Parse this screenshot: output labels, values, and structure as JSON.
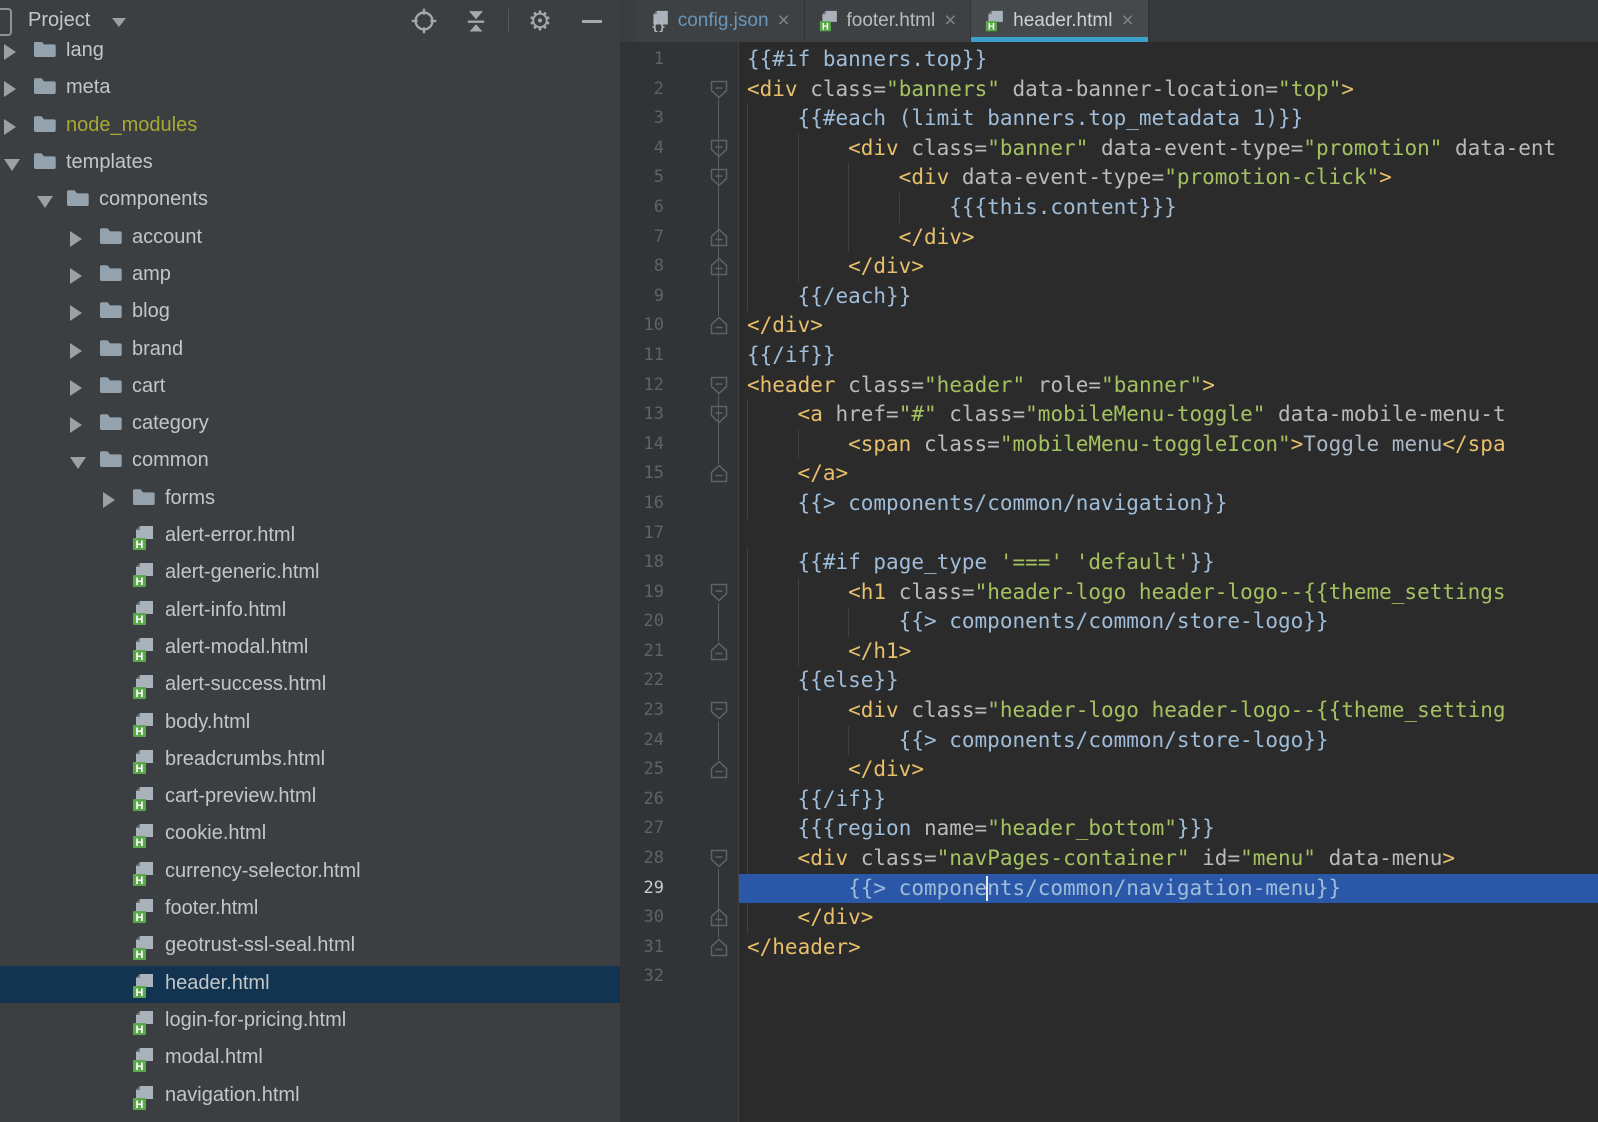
{
  "window": {
    "left_toolbar": {
      "title": "Project",
      "icons": [
        {
          "name": "locate-icon"
        },
        {
          "name": "collapse-all-icon"
        },
        {
          "name": "settings-gear-icon"
        },
        {
          "name": "hide-panel-icon"
        }
      ]
    }
  },
  "project_tree": {
    "items": [
      {
        "label": "lang",
        "level": 0,
        "kind": "folder",
        "state": "collapsed"
      },
      {
        "label": "meta",
        "level": 0,
        "kind": "folder",
        "state": "collapsed"
      },
      {
        "label": "node_modules",
        "level": 0,
        "kind": "folder",
        "state": "collapsed",
        "excluded": true
      },
      {
        "label": "templates",
        "level": 0,
        "kind": "folder",
        "state": "expanded"
      },
      {
        "label": "components",
        "level": 1,
        "kind": "folder",
        "state": "expanded"
      },
      {
        "label": "account",
        "level": 2,
        "kind": "folder",
        "state": "collapsed"
      },
      {
        "label": "amp",
        "level": 2,
        "kind": "folder",
        "state": "collapsed"
      },
      {
        "label": "blog",
        "level": 2,
        "kind": "folder",
        "state": "collapsed"
      },
      {
        "label": "brand",
        "level": 2,
        "kind": "folder",
        "state": "collapsed"
      },
      {
        "label": "cart",
        "level": 2,
        "kind": "folder",
        "state": "collapsed"
      },
      {
        "label": "category",
        "level": 2,
        "kind": "folder",
        "state": "collapsed"
      },
      {
        "label": "common",
        "level": 2,
        "kind": "folder",
        "state": "expanded"
      },
      {
        "label": "forms",
        "level": 3,
        "kind": "folder",
        "state": "collapsed"
      },
      {
        "label": "alert-error.html",
        "level": 3,
        "kind": "html"
      },
      {
        "label": "alert-generic.html",
        "level": 3,
        "kind": "html"
      },
      {
        "label": "alert-info.html",
        "level": 3,
        "kind": "html"
      },
      {
        "label": "alert-modal.html",
        "level": 3,
        "kind": "html"
      },
      {
        "label": "alert-success.html",
        "level": 3,
        "kind": "html"
      },
      {
        "label": "body.html",
        "level": 3,
        "kind": "html"
      },
      {
        "label": "breadcrumbs.html",
        "level": 3,
        "kind": "html"
      },
      {
        "label": "cart-preview.html",
        "level": 3,
        "kind": "html"
      },
      {
        "label": "cookie.html",
        "level": 3,
        "kind": "html"
      },
      {
        "label": "currency-selector.html",
        "level": 3,
        "kind": "html"
      },
      {
        "label": "footer.html",
        "level": 3,
        "kind": "html"
      },
      {
        "label": "geotrust-ssl-seal.html",
        "level": 3,
        "kind": "html"
      },
      {
        "label": "header.html",
        "level": 3,
        "kind": "html",
        "selected": true
      },
      {
        "label": "login-for-pricing.html",
        "level": 3,
        "kind": "html"
      },
      {
        "label": "modal.html",
        "level": 3,
        "kind": "html"
      },
      {
        "label": "navigation.html",
        "level": 3,
        "kind": "html"
      }
    ]
  },
  "editor": {
    "tabs": [
      {
        "label": "config.json",
        "icon": "json-file-icon",
        "state": "modified"
      },
      {
        "label": "footer.html",
        "icon": "html-file-icon",
        "state": "normal"
      },
      {
        "label": "header.html",
        "icon": "html-file-icon",
        "state": "active"
      }
    ],
    "close_glyph": "×",
    "code": {
      "fold_connectors": [
        [
          2,
          10
        ],
        [
          12,
          15
        ],
        [
          19,
          21
        ],
        [
          23,
          25
        ],
        [
          28,
          31
        ]
      ],
      "lines": [
        {
          "n": 1,
          "i": 0,
          "t": [
            [
              "hb",
              "{{#if banners.top}}"
            ]
          ]
        },
        {
          "n": 2,
          "i": 0,
          "f": "s",
          "t": [
            [
              "tag",
              "<div"
            ],
            [
              "attr",
              " class="
            ],
            [
              "str",
              "\"banners\""
            ],
            [
              "attr",
              " data-banner-location="
            ],
            [
              "str",
              "\"top\""
            ],
            [
              "tag",
              ">"
            ]
          ]
        },
        {
          "n": 3,
          "i": 4,
          "t": [
            [
              "hb",
              "{{#each (limit banners.top_metadata 1)}}"
            ]
          ]
        },
        {
          "n": 4,
          "i": 8,
          "f": "s",
          "t": [
            [
              "tag",
              "<div"
            ],
            [
              "attr",
              " class="
            ],
            [
              "str",
              "\"banner\""
            ],
            [
              "attr",
              " data-event-type="
            ],
            [
              "str",
              "\"promotion\""
            ],
            [
              "attr",
              " data-ent"
            ]
          ]
        },
        {
          "n": 5,
          "i": 12,
          "f": "s",
          "t": [
            [
              "tag",
              "<div"
            ],
            [
              "attr",
              " data-event-type="
            ],
            [
              "str",
              "\"promotion-click\""
            ],
            [
              "tag",
              ">"
            ]
          ]
        },
        {
          "n": 6,
          "i": 16,
          "t": [
            [
              "hb",
              "{{{this.content}}}"
            ]
          ]
        },
        {
          "n": 7,
          "i": 12,
          "f": "e",
          "t": [
            [
              "tag",
              "</div>"
            ]
          ]
        },
        {
          "n": 8,
          "i": 8,
          "f": "e",
          "t": [
            [
              "tag",
              "</div>"
            ]
          ]
        },
        {
          "n": 9,
          "i": 4,
          "t": [
            [
              "hb",
              "{{/each}}"
            ]
          ]
        },
        {
          "n": 10,
          "i": 0,
          "f": "e",
          "t": [
            [
              "tag",
              "</div>"
            ]
          ]
        },
        {
          "n": 11,
          "i": 0,
          "t": [
            [
              "hb",
              "{{/if}}"
            ]
          ]
        },
        {
          "n": 12,
          "i": 0,
          "f": "s",
          "t": [
            [
              "tag",
              "<header"
            ],
            [
              "attr",
              " class="
            ],
            [
              "str",
              "\"header\""
            ],
            [
              "attr",
              " role="
            ],
            [
              "str",
              "\"banner\""
            ],
            [
              "tag",
              ">"
            ]
          ]
        },
        {
          "n": 13,
          "i": 4,
          "f": "s",
          "t": [
            [
              "tag",
              "<a"
            ],
            [
              "attr",
              " href="
            ],
            [
              "str",
              "\"#\""
            ],
            [
              "attr",
              " class="
            ],
            [
              "str",
              "\"mobileMenu-toggle\""
            ],
            [
              "attr",
              " data-mobile-menu-t"
            ]
          ]
        },
        {
          "n": 14,
          "i": 8,
          "t": [
            [
              "tag",
              "<span"
            ],
            [
              "attr",
              " class="
            ],
            [
              "str",
              "\"mobileMenu-toggleIcon\""
            ],
            [
              "tag",
              ">"
            ],
            [
              "txt",
              "Toggle menu"
            ],
            [
              "tag",
              "</spa"
            ]
          ]
        },
        {
          "n": 15,
          "i": 4,
          "f": "e",
          "t": [
            [
              "tag",
              "</a>"
            ]
          ]
        },
        {
          "n": 16,
          "i": 4,
          "t": [
            [
              "hb",
              "{{> components/common/navigation}}"
            ]
          ]
        },
        {
          "n": 17,
          "i": 0,
          "t": []
        },
        {
          "n": 18,
          "i": 4,
          "t": [
            [
              "hb",
              "{{#if page_type "
            ],
            [
              "str",
              "'==='"
            ],
            [
              "hb",
              " "
            ],
            [
              "str",
              "'default'"
            ],
            [
              "hb",
              "}}"
            ]
          ]
        },
        {
          "n": 19,
          "i": 8,
          "f": "s",
          "t": [
            [
              "tag",
              "<h1"
            ],
            [
              "attr",
              " class="
            ],
            [
              "str",
              "\"header-logo header-logo--{{theme_settings"
            ]
          ]
        },
        {
          "n": 20,
          "i": 12,
          "t": [
            [
              "hb",
              "{{> components/common/store-logo}}"
            ]
          ]
        },
        {
          "n": 21,
          "i": 8,
          "f": "e",
          "t": [
            [
              "tag",
              "</h1>"
            ]
          ]
        },
        {
          "n": 22,
          "i": 4,
          "t": [
            [
              "hb",
              "{{else}}"
            ]
          ]
        },
        {
          "n": 23,
          "i": 8,
          "f": "s",
          "t": [
            [
              "tag",
              "<div"
            ],
            [
              "attr",
              " class="
            ],
            [
              "str",
              "\"header-logo header-logo--{{theme_setting"
            ]
          ]
        },
        {
          "n": 24,
          "i": 12,
          "t": [
            [
              "hb",
              "{{> components/common/store-logo}}"
            ]
          ]
        },
        {
          "n": 25,
          "i": 8,
          "f": "e",
          "t": [
            [
              "tag",
              "</div>"
            ]
          ]
        },
        {
          "n": 26,
          "i": 4,
          "t": [
            [
              "hb",
              "{{/if}}"
            ]
          ]
        },
        {
          "n": 27,
          "i": 4,
          "t": [
            [
              "hb",
              "{{{region "
            ],
            [
              "attr",
              "name="
            ],
            [
              "str",
              "\"header_bottom\""
            ],
            [
              "hb",
              "}}}"
            ]
          ]
        },
        {
          "n": 28,
          "i": 4,
          "f": "s",
          "t": [
            [
              "tag",
              "<div"
            ],
            [
              "attr",
              " class="
            ],
            [
              "str",
              "\"navPages-container\""
            ],
            [
              "attr",
              " id="
            ],
            [
              "str",
              "\"menu\""
            ],
            [
              "attr",
              " data-menu"
            ],
            [
              "tag",
              ">"
            ]
          ]
        },
        {
          "n": 29,
          "i": 8,
          "sel": true,
          "t": [
            [
              "hb",
              "{{> compone"
            ],
            [
              "caret",
              ""
            ],
            [
              "hb",
              "nts/common/navigation-menu}}"
            ]
          ]
        },
        {
          "n": 30,
          "i": 4,
          "f": "e",
          "t": [
            [
              "tag",
              "</div>"
            ]
          ]
        },
        {
          "n": 31,
          "i": 0,
          "f": "e",
          "t": [
            [
              "tag",
              "</header>"
            ]
          ]
        },
        {
          "n": 32,
          "i": 0,
          "t": []
        }
      ]
    }
  },
  "colors": {
    "panel_bg": "#3c3f41",
    "editor_bg": "#2b2b2b",
    "gutter_bg": "#313335",
    "tree_selection": "#123450",
    "editor_selection": "#2b57a8",
    "tab_underline": "#3aa1c9",
    "tag": "#e8bf6a",
    "attribute": "#bababa",
    "string": "#a5c261",
    "handlebars": "#9fbdd9",
    "html_text": "#a9b7c6",
    "excluded_folder": "#a8a832",
    "line_number": "#606366",
    "modified_tab": "#6897bb",
    "html_badge_green": "#5ba74b"
  }
}
